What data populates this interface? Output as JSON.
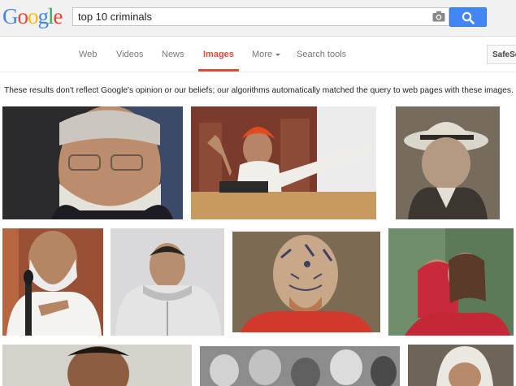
{
  "logo": {
    "text": "Google",
    "letters": [
      "G",
      "o",
      "o",
      "g",
      "l",
      "e"
    ],
    "colors": [
      "#4285f4",
      "#ea4335",
      "#fbbc05",
      "#4285f4",
      "#34a853",
      "#ea4335"
    ]
  },
  "search": {
    "query": "top 10 criminals"
  },
  "icons": {
    "camera": "camera-icon",
    "search": "search-icon"
  },
  "tabs": [
    {
      "label": "Web"
    },
    {
      "label": "Videos"
    },
    {
      "label": "News"
    },
    {
      "label": "Images",
      "active": true
    },
    {
      "label": "More"
    },
    {
      "label": "Search tools"
    }
  ],
  "safesearch": {
    "label": "SafeSearch"
  },
  "disclaimer": "These results don't reflect Google's opinion or our beliefs; our algorithms automatically matched the query to web pages with these images.",
  "colors": {
    "accent": "#dd4b39",
    "button": "#4285f4"
  }
}
